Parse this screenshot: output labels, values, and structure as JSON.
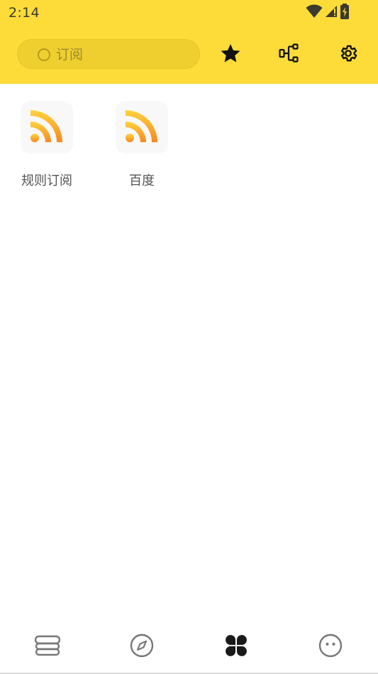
{
  "status_bar": {
    "time": "2:14"
  },
  "toolbar": {
    "search": {
      "placeholder": "订阅",
      "value": ""
    },
    "icons": [
      "star-icon",
      "rule-tree-icon",
      "gear-icon"
    ]
  },
  "subscriptions": [
    {
      "label": "规则订阅",
      "icon": "rss-icon"
    },
    {
      "label": "百度",
      "icon": "rss-icon"
    }
  ],
  "bottom_nav": {
    "items": [
      {
        "icon": "bookshelf-icon",
        "selected": false
      },
      {
        "icon": "compass-icon",
        "selected": false
      },
      {
        "icon": "subscription-grid-icon",
        "selected": true
      },
      {
        "icon": "face-icon",
        "selected": false
      }
    ]
  },
  "colors": {
    "accent": "#fddc3a",
    "search_bg": "#efcf30",
    "rss_gradient_start": "#ffd23f",
    "rss_gradient_end": "#f58a1f",
    "label_text": "#555555",
    "nav_icon": "#777777",
    "nav_icon_selected": "#1a1a1a"
  }
}
